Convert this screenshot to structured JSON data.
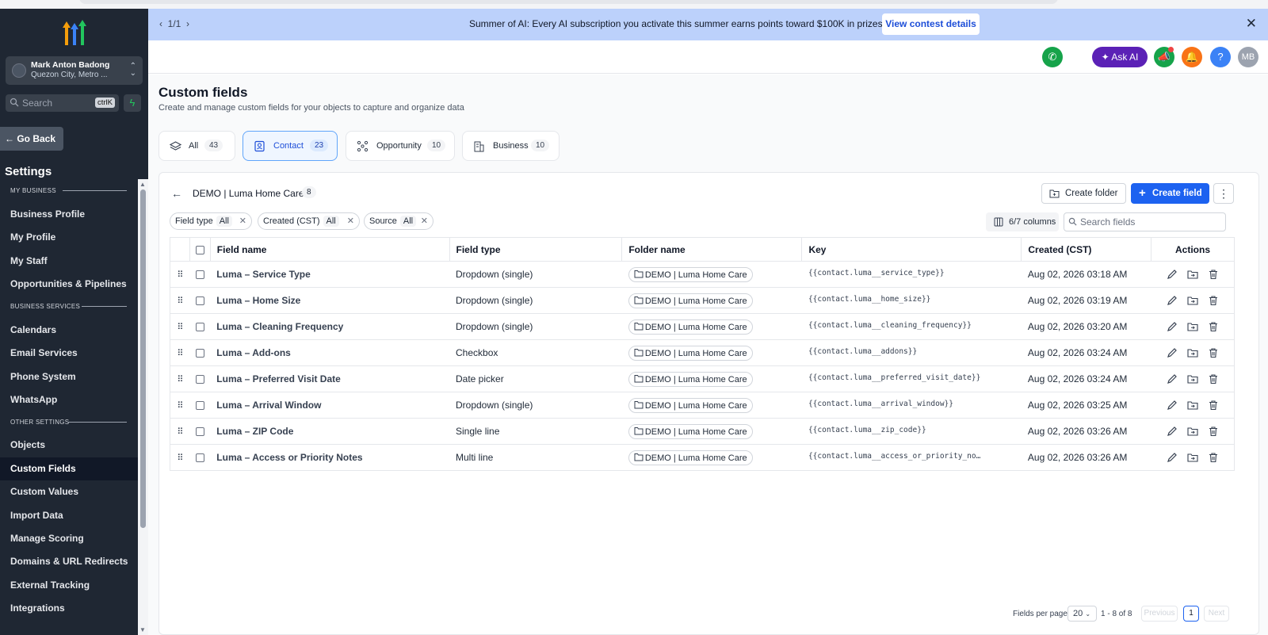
{
  "banner": {
    "pager": "1/1",
    "message": "Summer of AI: Every AI subscription you activate this summer earns points toward $100K in prizes.",
    "button": "View contest details"
  },
  "sidebar": {
    "user_name": "Mark Anton Badong",
    "user_location": "Quezon City, Metro ...",
    "search_placeholder": "Search",
    "search_shortcut": "ctrlK",
    "go_back": "Go Back",
    "settings_title": "Settings",
    "sections": [
      {
        "label": "MY BUSINESS",
        "items": [
          "Business Profile",
          "My Profile",
          "My Staff",
          "Opportunities & Pipelines"
        ]
      },
      {
        "label": "BUSINESS SERVICES",
        "items": [
          "Calendars",
          "Email Services",
          "Phone System",
          "WhatsApp"
        ]
      },
      {
        "label": "OTHER SETTINGS",
        "items": [
          "Objects",
          "Custom Fields",
          "Custom Values",
          "Import Data",
          "Manage Scoring",
          "Domains & URL Redirects",
          "External Tracking",
          "Integrations"
        ]
      }
    ],
    "active_item": "Custom Fields"
  },
  "header": {
    "ask_ai": "Ask AI",
    "avatar_initials": "MB"
  },
  "page": {
    "title": "Custom fields",
    "subtitle": "Create and manage custom fields for your objects to capture and organize data"
  },
  "tabs": [
    {
      "label": "All",
      "count": "43"
    },
    {
      "label": "Contact",
      "count": "23"
    },
    {
      "label": "Opportunity",
      "count": "10"
    },
    {
      "label": "Business",
      "count": "10"
    }
  ],
  "selected_tab": "Contact",
  "folder": {
    "name": "DEMO | Luma Home Care",
    "count": "8",
    "create_folder": "Create folder",
    "create_field": "Create field"
  },
  "filters": [
    {
      "label": "Field type",
      "value": "All"
    },
    {
      "label": "Created (CST)",
      "value": "All"
    },
    {
      "label": "Source",
      "value": "All"
    }
  ],
  "columns_button": "6/7 columns",
  "search_fields_placeholder": "Search fields",
  "table": {
    "headers": [
      "Field name",
      "Field type",
      "Folder name",
      "Key",
      "Created (CST)",
      "Actions"
    ],
    "rows": [
      {
        "name": "Luma – Service Type",
        "type": "Dropdown (single)",
        "folder": "DEMO | Luma Home Care",
        "key": "{{contact.luma__service_type}}",
        "created": "Aug 02, 2026 03:18 AM"
      },
      {
        "name": "Luma – Home Size",
        "type": "Dropdown (single)",
        "folder": "DEMO | Luma Home Care",
        "key": "{{contact.luma__home_size}}",
        "created": "Aug 02, 2026 03:19 AM"
      },
      {
        "name": "Luma – Cleaning Frequency",
        "type": "Dropdown (single)",
        "folder": "DEMO | Luma Home Care",
        "key": "{{contact.luma__cleaning_frequency}}",
        "created": "Aug 02, 2026 03:20 AM"
      },
      {
        "name": "Luma – Add-ons",
        "type": "Checkbox",
        "folder": "DEMO | Luma Home Care",
        "key": "{{contact.luma__addons}}",
        "created": "Aug 02, 2026 03:24 AM"
      },
      {
        "name": "Luma – Preferred Visit Date",
        "type": "Date picker",
        "folder": "DEMO | Luma Home Care",
        "key": "{{contact.luma__preferred_visit_date}}",
        "created": "Aug 02, 2026 03:24 AM"
      },
      {
        "name": "Luma – Arrival Window",
        "type": "Dropdown (single)",
        "folder": "DEMO | Luma Home Care",
        "key": "{{contact.luma__arrival_window}}",
        "created": "Aug 02, 2026 03:25 AM"
      },
      {
        "name": "Luma – ZIP Code",
        "type": "Single line",
        "folder": "DEMO | Luma Home Care",
        "key": "{{contact.luma__zip_code}}",
        "created": "Aug 02, 2026 03:26 AM"
      },
      {
        "name": "Luma – Access or Priority Notes",
        "type": "Multi line",
        "folder": "DEMO | Luma Home Care",
        "key": "{{contact.luma__access_or_priority_no…",
        "created": "Aug 02, 2026 03:26 AM"
      }
    ]
  },
  "pagination": {
    "per_page_label": "Fields per page",
    "per_page": "20",
    "range": "1 - 8 of 8",
    "previous": "Previous",
    "page": "1",
    "next": "Next"
  },
  "colors": {
    "sidebar_bg": "#1f2733",
    "banner_bg": "#bcd1fb",
    "primary": "#1d62f0",
    "ask_ai": "#5b21b6",
    "phone": "#16a34a",
    "bell": "#f97316",
    "help": "#3b82f6"
  }
}
